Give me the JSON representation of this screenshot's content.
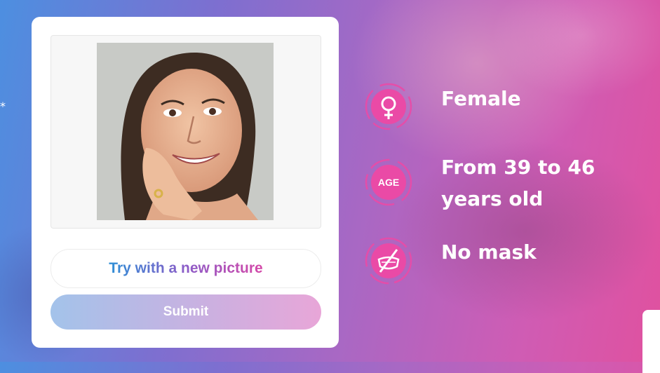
{
  "upload": {
    "try_label": "Try with a new picture",
    "submit_label": "Submit"
  },
  "results": {
    "gender": {
      "label": "Female",
      "icon": "female-icon"
    },
    "age": {
      "label": "From 39 to 46 years old",
      "icon": "age-badge-icon",
      "badge_text": "AGE"
    },
    "mask": {
      "label": "No mask",
      "icon": "no-mask-icon"
    }
  },
  "colors": {
    "accent_pink": "#ea4aa6",
    "gradient_blue": "#2e8fd6",
    "gradient_purple": "#8c5cc8",
    "gradient_pink": "#d548a8"
  },
  "edge_glyph": "*"
}
